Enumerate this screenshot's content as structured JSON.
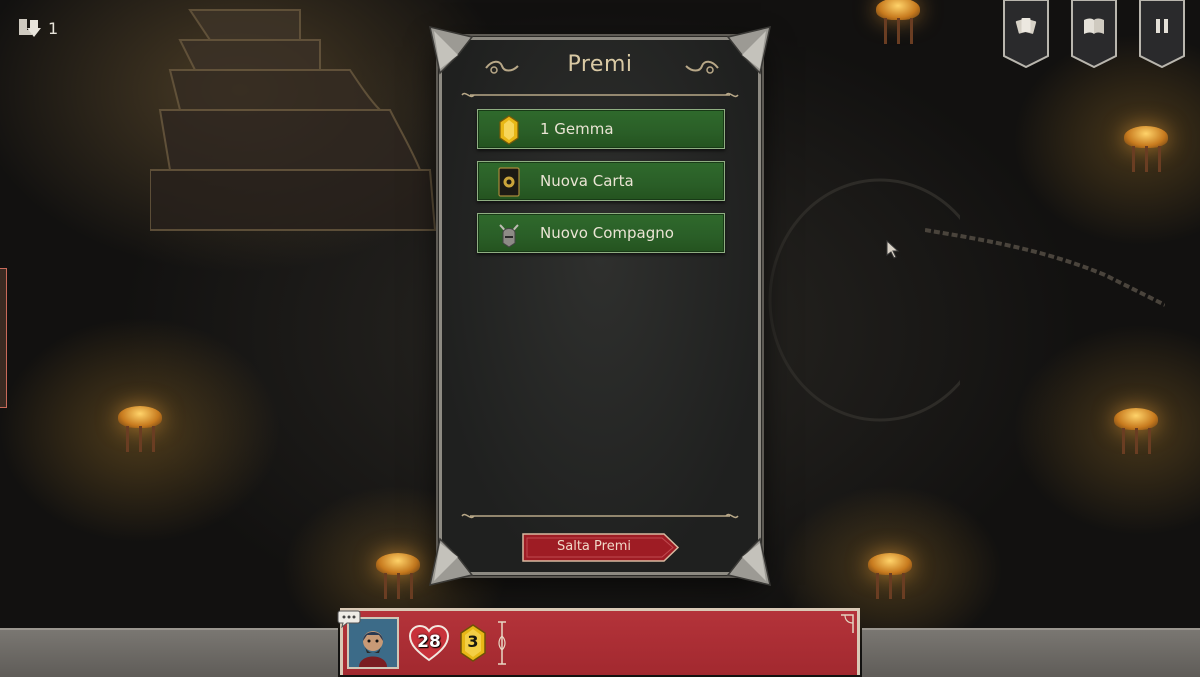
{
  "top_left": {
    "count": "1",
    "icon": "boot-arrow-icon"
  },
  "top_right_buttons": [
    {
      "name": "deck-button",
      "icon": "cards-icon"
    },
    {
      "name": "journal-button",
      "icon": "book-icon"
    },
    {
      "name": "pause-button",
      "icon": "pause-icon"
    }
  ],
  "rewards_panel": {
    "title": "Premi",
    "items": [
      {
        "label": "1 Gemma",
        "icon": "gem-icon"
      },
      {
        "label": "Nuova Carta",
        "icon": "card-icon"
      },
      {
        "label": "Nuovo Compagno",
        "icon": "helmet-icon"
      }
    ],
    "skip_label": "Salta Premi"
  },
  "hud": {
    "health": "28",
    "gems": "3",
    "portrait_icon": "hero-portrait",
    "speech_icon": "speech-bubble-icon"
  },
  "colors": {
    "reward_green": "#2a5e27",
    "skip_red": "#9e1c24",
    "hud_red": "#a82d33",
    "title_gold": "#d9c9a4"
  }
}
